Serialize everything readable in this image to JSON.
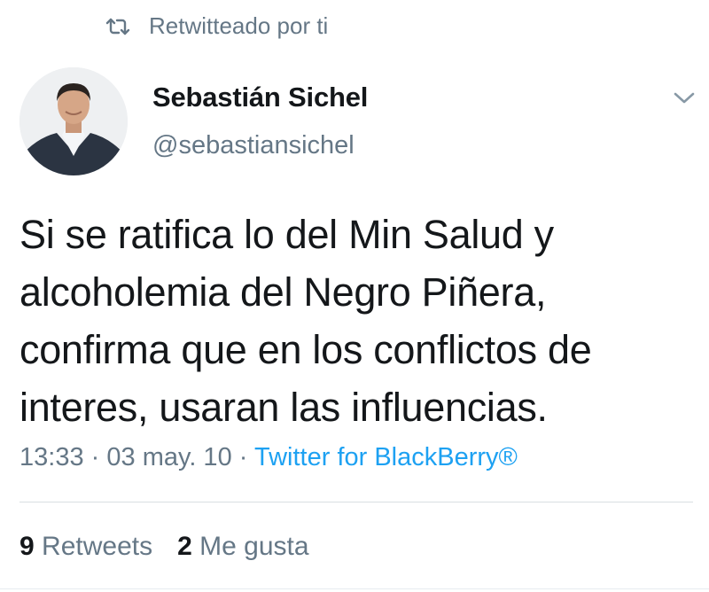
{
  "retweet_header": {
    "icon": "retweet-icon",
    "label": "Retwitteado por ti"
  },
  "author": {
    "name": "Sebastián Sichel",
    "handle": "@sebastiansichel",
    "avatar": "avatar-photo"
  },
  "menu_icon": "chevron-down-icon",
  "tweet": {
    "lines": [
      "Si se ratifica lo del Min Salud y",
      "alcoholemia del Negro Piñera,",
      "confirma que en los conflictos de",
      "interes, usaran las influencias."
    ]
  },
  "meta": {
    "time": "13:33",
    "separator": "·",
    "date": "03 may. 10",
    "source": "Twitter for BlackBerry®"
  },
  "stats": {
    "retweets_count": "9",
    "retweets_label": "Retweets",
    "likes_count": "2",
    "likes_label": "Me gusta"
  },
  "colors": {
    "text": "#14171a",
    "secondary": "#657786",
    "link": "#1da1f2",
    "divider": "#d9dee2"
  }
}
